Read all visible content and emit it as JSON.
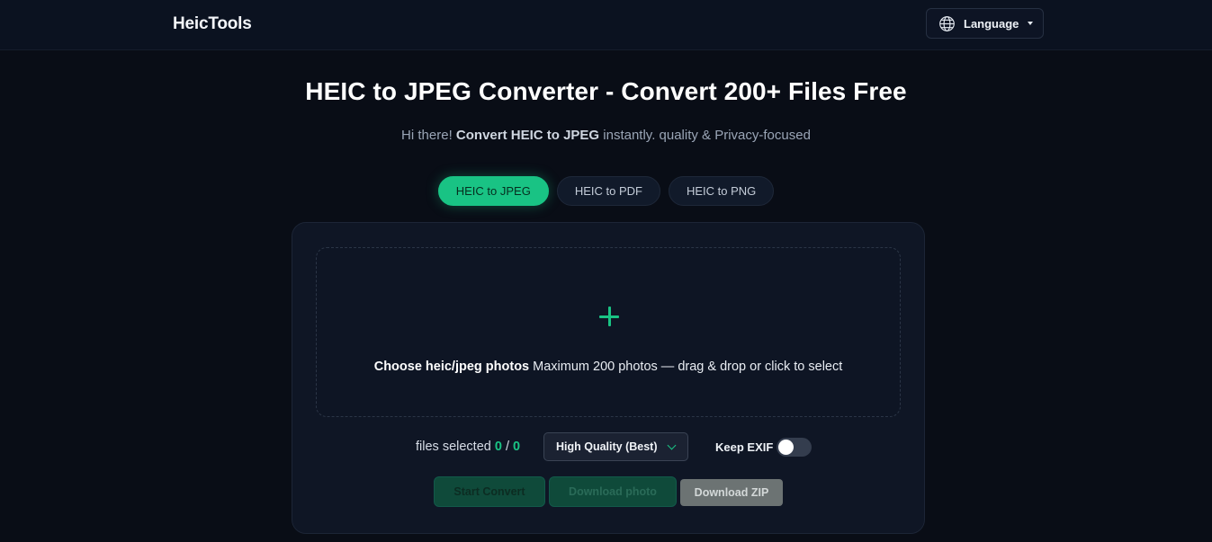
{
  "header": {
    "brand": "HeicTools",
    "language_label": "Language",
    "language_icon": "globe-icon"
  },
  "hero": {
    "title": "HEIC to JPEG Converter - Convert 200+ Files Free",
    "subtitle_prefix": "Hi there! ",
    "subtitle_bold": "Convert HEIC to JPEG",
    "subtitle_suffix": " instantly. quality & Privacy-focused"
  },
  "tabs": [
    {
      "label": "HEIC to JPEG",
      "active": true
    },
    {
      "label": "HEIC to PDF",
      "active": false
    },
    {
      "label": "HEIC to PNG",
      "active": false
    }
  ],
  "dropzone": {
    "icon": "plus-icon",
    "bold_text": "Choose heic/jpeg photos",
    "text": " Maximum 200 photos — drag & drop or click to select"
  },
  "controls": {
    "files_label": "files selected ",
    "selected_count": "0",
    "separator": "/",
    "total_count": "0",
    "quality_value": "High Quality (Best)",
    "exif_label": "Keep EXIF",
    "exif_enabled": false
  },
  "actions": {
    "convert_label": "Start Convert",
    "download_photo_label": "Download photo",
    "download_zip_label": "Download ZIP"
  },
  "colors": {
    "accent": "#19c384",
    "background": "#090d16",
    "panel": "#0f1625"
  }
}
